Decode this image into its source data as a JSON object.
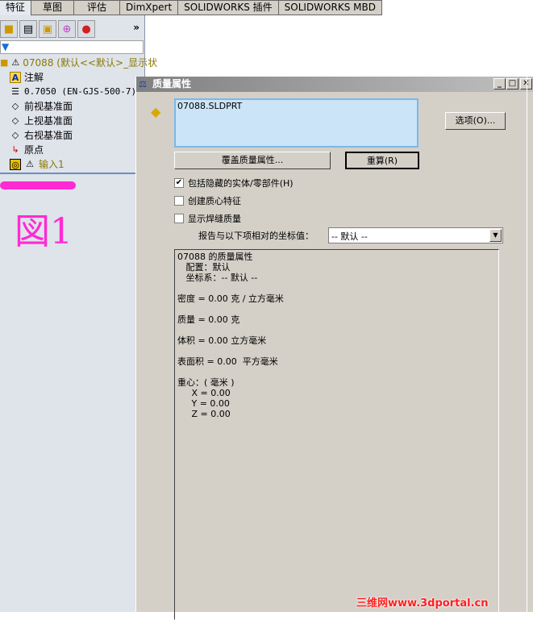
{
  "tabs": [
    "特征",
    "草图",
    "评估",
    "DimXpert",
    "SOLIDWORKS 插件",
    "SOLIDWORKS MBD"
  ],
  "feature_tree": {
    "root": "07088  (默认<<默认>_显示状",
    "items": [
      {
        "label": "注解",
        "icon": "annotation-icon"
      },
      {
        "label": "0.7050 (EN-GJS-500-7)",
        "icon": "material-icon"
      },
      {
        "label": "前视基准面",
        "icon": "plane-icon"
      },
      {
        "label": "上视基准面",
        "icon": "plane-icon"
      },
      {
        "label": "右视基准面",
        "icon": "plane-icon"
      },
      {
        "label": "原点",
        "icon": "origin-icon"
      },
      {
        "label": "输入1",
        "icon": "imported-body-icon"
      }
    ],
    "more": "»"
  },
  "annotation": "図1",
  "dialog": {
    "title": "质量属性",
    "file": "07088.SLDPRT",
    "options_btn": "选项(O)...",
    "override_btn": "覆盖质量属性...",
    "recalc_btn": "重算(R)",
    "checkboxes": [
      {
        "label": "包括隐藏的实体/零部件(H)",
        "checked": true
      },
      {
        "label": "创建质心特征",
        "checked": false
      },
      {
        "label": "显示焊缝质量",
        "checked": false
      }
    ],
    "coord_label": "报告与以下项相对的坐标值：",
    "coord_value": "-- 默认 --",
    "results": "07088 的质量属性\n   配置：默认\n   坐标系：-- 默认 --\n\n密度 = 0.00 克 / 立方毫米\n\n质量 = 0.00 克\n\n体积 = 0.00 立方毫米\n\n表面积 = 0.00  平方毫米\n\n重心：( 毫米 )\n     X = 0.00\n     Y = 0.00\n     Z = 0.00"
  },
  "watermark": "三维网www.3dportal.cn"
}
